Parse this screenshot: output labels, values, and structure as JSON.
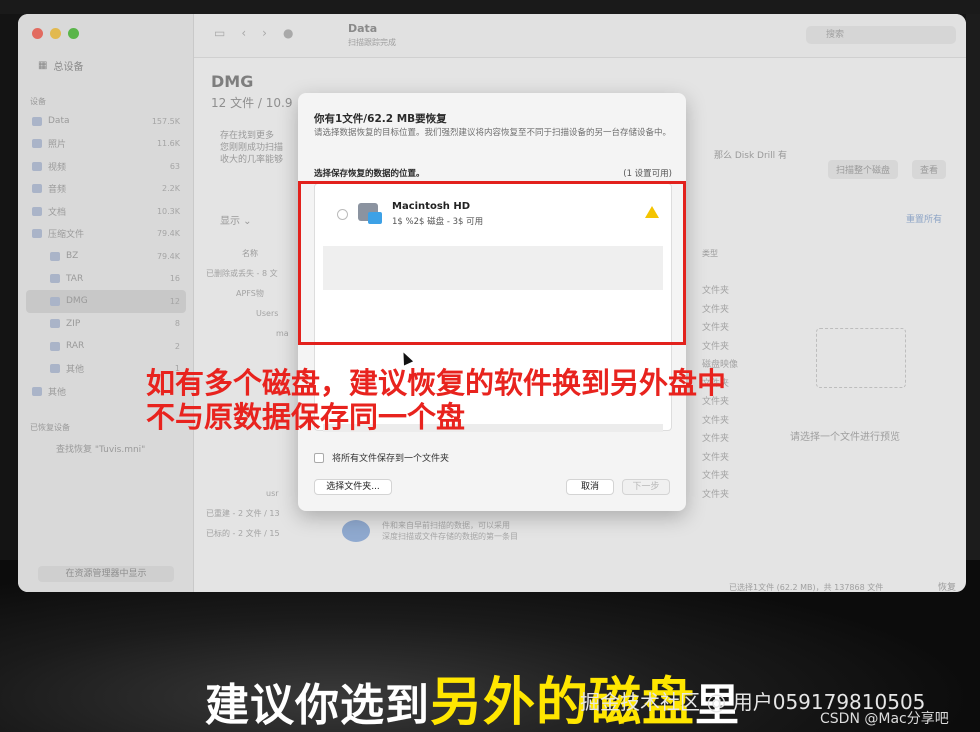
{
  "window": {
    "title": "Data",
    "subtitle": "扫描跟踪完成",
    "search_placeholder": "搜索"
  },
  "sidebar": {
    "top_label": "总设备",
    "section_label": "设备",
    "items": [
      {
        "label": "Data",
        "count": "157.5K"
      },
      {
        "label": "照片",
        "count": "11.6K"
      },
      {
        "label": "视频",
        "count": "63"
      },
      {
        "label": "音频",
        "count": "2.2K"
      },
      {
        "label": "文档",
        "count": "10.3K"
      },
      {
        "label": "压缩文件",
        "count": "79.4K"
      },
      {
        "label": "BZ",
        "count": "79.4K"
      },
      {
        "label": "TAR",
        "count": "16"
      },
      {
        "label": "DMG",
        "count": "12"
      },
      {
        "label": "ZIP",
        "count": "8"
      },
      {
        "label": "RAR",
        "count": "2"
      },
      {
        "label": "其他",
        "count": "1"
      },
      {
        "label": "其他",
        "count": ""
      }
    ],
    "section2_label": "已恢复设备",
    "recent_item": "查找恢复 \"Tuvis.mni\"",
    "bottom_button": "在资源管理器中显示"
  },
  "main": {
    "title": "DMG",
    "subtitle": "12 文件 / 10.9",
    "warning_lines": [
      "存在找到更多",
      "您刚刚成功扫描",
      "收大的几率能够"
    ],
    "right_text": "那么 Disk Drill 有",
    "btn_scan_all": "扫描整个磁盘",
    "btn_view": "查看",
    "link_recover_all": "重置所有",
    "show_button": "显示",
    "col_name": "名称",
    "col_type": "类型",
    "tree": [
      "已删除或丢失 - 8 文",
      "APFS物",
      "Users",
      "ma",
      "",
      "",
      "",
      "",
      "",
      "",
      "",
      "usr",
      "已重建 - 2 文件 / 13",
      "已标的 - 2 文件 / 15"
    ],
    "types": [
      "文件夹",
      "文件夹",
      "文件夹",
      "文件夹",
      "磁盘映像",
      "文件夹",
      "文件夹",
      "文件夹",
      "文件夹",
      "文件夹",
      "文件夹",
      "文件夹"
    ],
    "preview_text": "请选择一个文件进行预览",
    "info_lines": [
      "件和来自早前扫描的数据，可以采用",
      "深度扫描或文件存储的数据的第一条目"
    ],
    "status_text": "已选择1文件 (62.2 MB)，共 137868 文件",
    "status_button": "恢复"
  },
  "dialog": {
    "title": "你有1文件/62.2 MB要恢复",
    "desc": "请选择数据恢复的目标位置。我们强烈建议将内容恢复至不同于扫描设备的另一台存储设备中。",
    "label": "选择保存恢复的数据的位置。",
    "count": "(1 设置可用)",
    "disk_name": "Macintosh HD",
    "disk_info": "1$ %2$ 磁盘 - 3$ 可用",
    "checkbox_label": "将所有文件保存到一个文件夹",
    "btn_choose": "选择文件夹...",
    "btn_cancel": "取消",
    "btn_next": "下一步"
  },
  "annotation": {
    "line1": "如有多个磁盘，建议恢复的软件换到另外盘中",
    "line2": "不与原数据保存同一个盘"
  },
  "caption": {
    "part1": "建议你选到",
    "part2": "另外的磁盘",
    "part3": "里"
  },
  "watermark": {
    "line1": "掘金技术社区 @ 用户059179810505",
    "line2": "CSDN @Mac分享吧"
  },
  "colors": {
    "highlight": "#e2211c",
    "caption_highlight": "#ffe600",
    "warning": "#f4c400",
    "disk_accent": "#3da1e6"
  }
}
